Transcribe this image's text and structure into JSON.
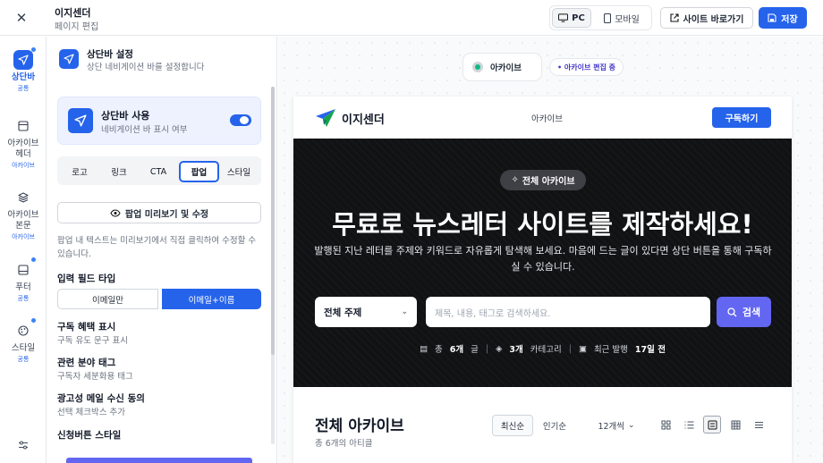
{
  "topbar": {
    "title": "이지센더",
    "subtitle": "페이지 편집",
    "device_pc": "PC",
    "device_mobile": "모바일",
    "site_link": "사이트 바로가기",
    "save": "저장"
  },
  "rail": {
    "items": [
      {
        "label": "상단바",
        "sub": "공통",
        "icon": "send-icon",
        "active": true
      },
      {
        "label": "아카이브\n헤더",
        "sub": "아카이브",
        "icon": "layout-icon"
      },
      {
        "label": "아카이브\n본문",
        "sub": "아카이브",
        "icon": "layers-icon"
      },
      {
        "label": "푸터",
        "sub": "공통",
        "icon": "footer-icon"
      },
      {
        "label": "스타일",
        "sub": "공통",
        "icon": "palette-icon"
      }
    ]
  },
  "panel": {
    "section_title": "상단바 설정",
    "section_desc": "상단 네비게이션 바를 설정합니다",
    "use_title": "상단바 사용",
    "use_desc": "네비게이션 바 표시 여부",
    "use_enabled": true,
    "tabs": [
      "로고",
      "링크",
      "CTA",
      "팝업",
      "스타일"
    ],
    "active_tab": "팝업",
    "preview_button": "팝업 미리보기 및 수정",
    "help_text": "팝업 내 텍스트는 미리보기에서 직접 클릭하여 수정할 수 있습니다.",
    "input_type_label": "입력 필드 타입",
    "input_options": [
      "이메일만",
      "이메일+이름"
    ],
    "input_selected": "이메일+이름",
    "fields": [
      {
        "title": "구독 혜택 표시",
        "desc": "구독 유도 문구 표시"
      },
      {
        "title": "관련 분야 태그",
        "desc": "구독자 세분화용 태그"
      },
      {
        "title": "광고성 메일 수신 동의",
        "desc": "선택 체크박스 추가"
      },
      {
        "title": "신청버튼 스타일",
        "desc": ""
      }
    ]
  },
  "canvas": {
    "section_chip": "아카이브",
    "edit_badge": "• 아카이브 편집 중"
  },
  "site": {
    "brand": "이지센더",
    "nav_item": "아카이브",
    "subscribe": "구독하기",
    "hero_badge": "전체 아카이브",
    "hero_title": "무료로 뉴스레터 사이트를 제작하세요!",
    "hero_desc": "발행된 지난 레터를 주제와 키워드로 자유롭게 탐색해 보세요. 마음에 드는 글이 있다면 상단 버튼을 통해 구독하실 수 있습니다.",
    "topic_select": "전체 주제",
    "search_placeholder": "제목, 내용, 태그로 검색하세요.",
    "search_button": "검색",
    "stats": {
      "total_prefix": "총",
      "total_value": "6개",
      "total_suffix": "글",
      "cat_value": "3개",
      "cat_suffix": "카테고리",
      "recent_prefix": "최근 발행",
      "recent_value": "17일 전"
    },
    "archive_title": "전체 아카이브",
    "archive_count": "총 6개의 아티클",
    "sort_options": [
      "최신순",
      "인기순"
    ],
    "per_page": "12개씩"
  },
  "colors": {
    "accent": "#2563eb",
    "search_button": "#6366f1",
    "hero_bg": "#111214"
  }
}
